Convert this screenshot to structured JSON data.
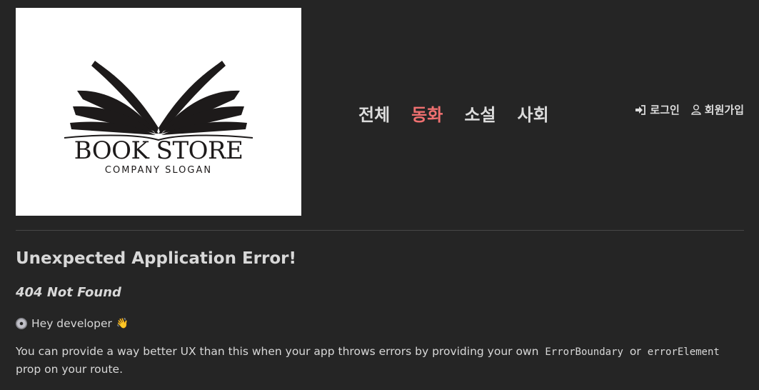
{
  "logo": {
    "title": "BOOK STORE",
    "slogan": "COMPANY SLOGAN"
  },
  "nav": {
    "items": [
      {
        "label": "전체",
        "active": false
      },
      {
        "label": "동화",
        "active": true
      },
      {
        "label": "소설",
        "active": false
      },
      {
        "label": "사회",
        "active": false
      }
    ],
    "active_color": "#f07070"
  },
  "auth": {
    "login_label": "로그인",
    "login_icon": "sign-in-icon",
    "signup_label": "회원가입",
    "signup_icon": "user-icon"
  },
  "error": {
    "title": "Unexpected Application Error!",
    "status": "404 Not Found",
    "hey_text": "Hey developer",
    "hey_disc_icon": "disc-icon",
    "hey_wave": "👋",
    "desc_pre": "You can provide a way better UX than this when your app throws errors by providing your own",
    "code1": "ErrorBoundary",
    "desc_mid": "or",
    "code2": "errorElement",
    "desc_post": "prop on your route."
  },
  "colors": {
    "background": "#252525",
    "text": "#dcdcdc",
    "logo_bg": "#ffffff"
  }
}
